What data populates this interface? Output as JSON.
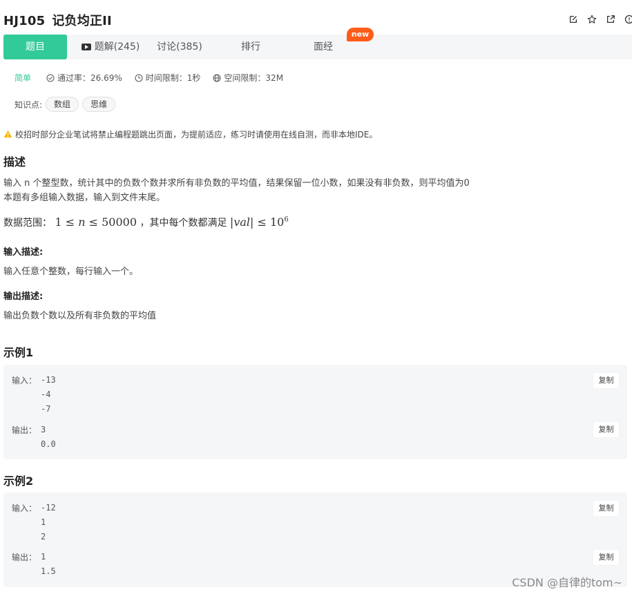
{
  "header": {
    "code": "HJ105",
    "name": "记负均正II"
  },
  "tabs": [
    {
      "label": "题目"
    },
    {
      "label": "题解(245)"
    },
    {
      "label": "讨论(385)"
    },
    {
      "label": "排行"
    },
    {
      "label": "面经"
    }
  ],
  "new_badge": "new",
  "meta": {
    "difficulty": "简单",
    "pass_rate": "通过率：26.69%",
    "time_limit": "时间限制：1秒",
    "space_limit": "空间限制：32M"
  },
  "knowledge": {
    "label": "知识点:",
    "tags": [
      "数组",
      "思维"
    ]
  },
  "notice": "校招时部分企业笔试将禁止编程题跳出页面，为提前适应，练习时请使用在线自测，而非本地IDE。",
  "description": {
    "heading": "描述",
    "line1": "输入 n 个整型数，统计其中的负数个数并求所有非负数的平均值，结果保留一位小数，如果没有非负数，则平均值为0",
    "line2": "本题有多组输入数据，输入到文件末尾。",
    "range_label": "数据范围：",
    "range_sep": "，其中每个数都满足"
  },
  "input_desc": {
    "heading": "输入描述:",
    "text": "输入任意个整数，每行输入一个。"
  },
  "output_desc": {
    "heading": "输出描述:",
    "text": "输出负数个数以及所有非负数的平均值"
  },
  "examples": [
    {
      "title": "示例1",
      "input_label": "输入：",
      "input_lines": [
        "-13",
        "-4",
        "-7"
      ],
      "output_label": "输出：",
      "output_lines": [
        "3",
        "0.0"
      ],
      "copy_label": "复制"
    },
    {
      "title": "示例2",
      "input_label": "输入：",
      "input_lines": [
        "-12",
        "1",
        "2"
      ],
      "output_label": "输出：",
      "output_lines": [
        "1",
        "1.5"
      ],
      "copy_label": "复制"
    }
  ],
  "watermark": "CSDN @自律的tom~",
  "colors": {
    "accent": "#32ca99",
    "badge": "#fe5c1a",
    "warning": "#f5b700"
  }
}
